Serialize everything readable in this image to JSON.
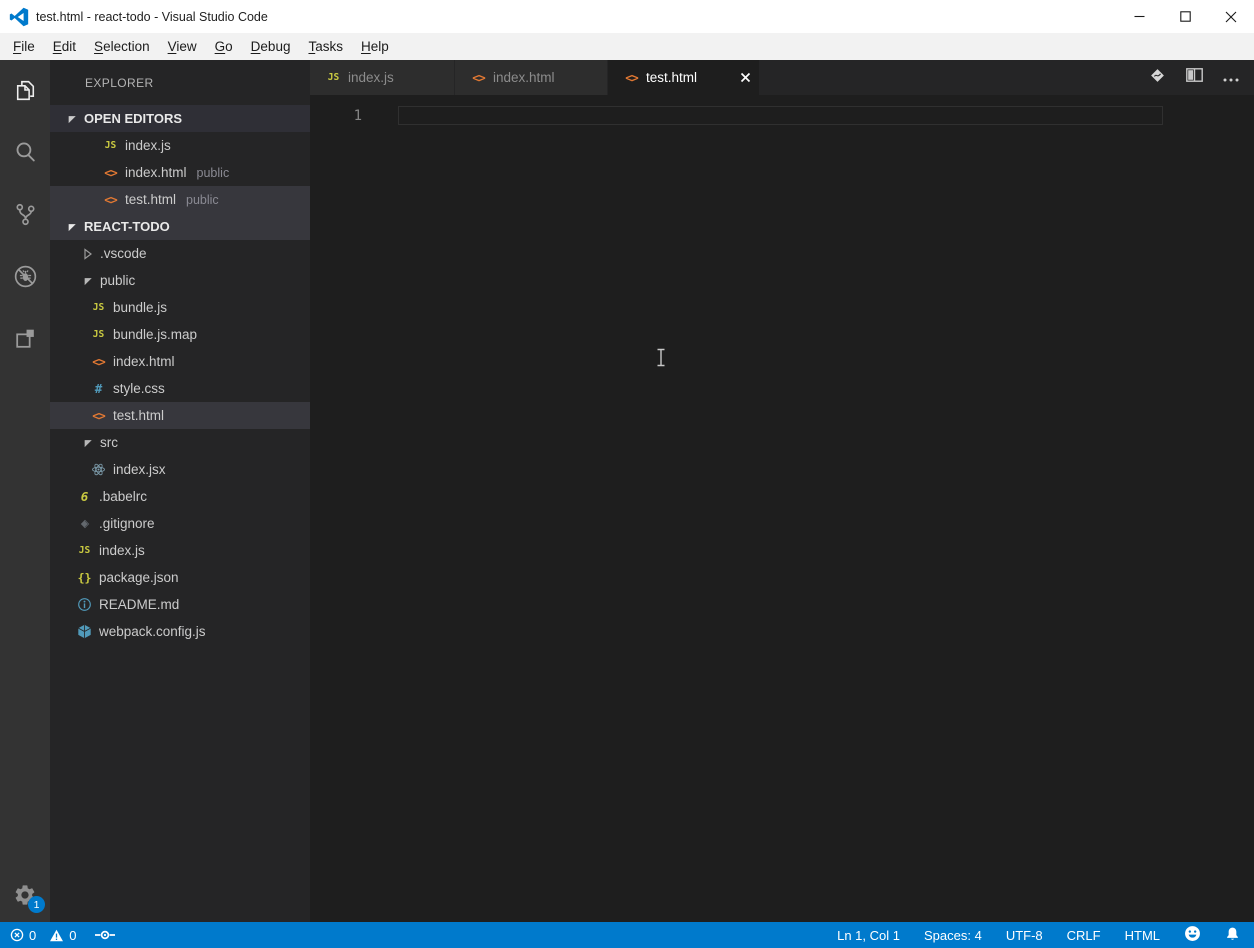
{
  "window": {
    "title": "test.html - react-todo - Visual Studio Code",
    "controls": [
      "minimize",
      "maximize",
      "close"
    ],
    "logo_icon": "vscode-logo"
  },
  "menubar": {
    "items": [
      {
        "key": "F",
        "rest": "ile"
      },
      {
        "key": "E",
        "rest": "dit"
      },
      {
        "key": "S",
        "rest": "election"
      },
      {
        "key": "V",
        "rest": "iew"
      },
      {
        "key": "G",
        "rest": "o"
      },
      {
        "key": "D",
        "rest": "ebug"
      },
      {
        "key": "T",
        "rest": "asks"
      },
      {
        "key": "H",
        "rest": "elp"
      }
    ]
  },
  "activity_bar": {
    "items": [
      "explorer",
      "search",
      "source-control",
      "debug",
      "extensions"
    ],
    "active_item": "explorer",
    "settings_icon": "gear-icon",
    "settings_badge": "1"
  },
  "sidebar": {
    "title": "EXPLORER",
    "open_editors": {
      "header": "OPEN EDITORS",
      "items": [
        {
          "name": "index.js",
          "icon": "js",
          "badge": ""
        },
        {
          "name": "index.html",
          "icon": "html",
          "badge": "public"
        },
        {
          "name": "test.html",
          "icon": "html",
          "badge": "public",
          "selected": true
        }
      ]
    },
    "project": {
      "header": "REACT-TODO",
      "tree": [
        {
          "name": ".vscode",
          "type": "folder-collapsed",
          "level": 0
        },
        {
          "name": "public",
          "type": "folder-expanded",
          "level": 0
        },
        {
          "name": "bundle.js",
          "icon": "js",
          "level": 1
        },
        {
          "name": "bundle.js.map",
          "icon": "js",
          "level": 1
        },
        {
          "name": "index.html",
          "icon": "html",
          "level": 1
        },
        {
          "name": "style.css",
          "icon": "css",
          "level": 1
        },
        {
          "name": "test.html",
          "icon": "html",
          "level": 1,
          "selected": true
        },
        {
          "name": "src",
          "type": "folder-expanded",
          "level": 0
        },
        {
          "name": "index.jsx",
          "icon": "react",
          "level": 1
        },
        {
          "name": ".babelrc",
          "icon": "babel",
          "level": 0
        },
        {
          "name": ".gitignore",
          "icon": "git",
          "level": 0
        },
        {
          "name": "index.js",
          "icon": "js",
          "level": 0
        },
        {
          "name": "package.json",
          "icon": "json",
          "level": 0
        },
        {
          "name": "README.md",
          "icon": "info",
          "level": 0
        },
        {
          "name": "webpack.config.js",
          "icon": "webpack",
          "level": 0
        }
      ]
    }
  },
  "icons": {
    "js": "JS",
    "html": "<>",
    "css": "#",
    "json": "{}",
    "babel": "6"
  },
  "editor": {
    "tabs": [
      {
        "label": "index.js",
        "icon": "js",
        "active": false
      },
      {
        "label": "index.html",
        "icon": "html",
        "active": false
      },
      {
        "label": "test.html",
        "icon": "html",
        "active": true
      }
    ],
    "actions": [
      "open-preview",
      "split-editor",
      "more-actions"
    ],
    "line_number": "1",
    "cursor": "text-ibeam"
  },
  "status_bar": {
    "errors": "0",
    "warnings": "0",
    "left_icons": [
      "error",
      "warning",
      "commit"
    ],
    "cursor_position": "Ln 1, Col 1",
    "indentation": "Spaces: 4",
    "encoding": "UTF-8",
    "line_ending": "CRLF",
    "language_mode": "HTML",
    "right_icons": [
      "feedback-smiley",
      "notifications-bell"
    ],
    "accent_color": "#007acc"
  }
}
